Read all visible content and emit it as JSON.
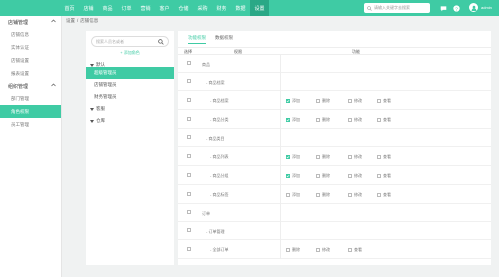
{
  "colors": {
    "accent": "#3fcba4",
    "accent_dark": "#2aa886"
  },
  "topnav": {
    "items": [
      "首页",
      "店铺",
      "商品",
      "订单",
      "营销",
      "客户",
      "仓储",
      "采购",
      "财务",
      "数据",
      "设置"
    ],
    "active": 10,
    "search_placeholder": "请输入关键字去搜索",
    "user": "admin",
    "icons": [
      "search-icon",
      "message-icon",
      "help-icon",
      "bell-icon",
      "avatar-icon"
    ]
  },
  "sidebar": {
    "groups": [
      {
        "title": "店铺管理",
        "expanded": true,
        "items": [
          "店铺信息",
          "实体认证",
          "店铺设置",
          "报表设置"
        ]
      },
      {
        "title": "组织管理",
        "expanded": true,
        "items": [
          "部门管理",
          "角色权限",
          "员工管理"
        ]
      }
    ],
    "active_item": "角色权限"
  },
  "breadcrumb": [
    "设置",
    "/",
    "店铺信息"
  ],
  "role_tree": {
    "search_placeholder": "搜索人员名或者",
    "add_label": "+ 添加角色",
    "nodes": [
      {
        "label": "默认",
        "level": 0,
        "expanded": true
      },
      {
        "label": "超级管理员",
        "level": 1,
        "active": true
      },
      {
        "label": "店铺管理员",
        "level": 1
      },
      {
        "label": "财务管理员",
        "level": 1
      },
      {
        "label": "客服",
        "level": 0,
        "expanded": true
      },
      {
        "label": "仓库",
        "level": 0,
        "expanded": true
      }
    ]
  },
  "permissions": {
    "tabs": [
      "功能权限",
      "数据权限"
    ],
    "active_tab": 0,
    "columns": [
      "选择",
      "权限",
      "功能"
    ],
    "rows": [
      {
        "name": "商品",
        "indent": 0,
        "options": []
      },
      {
        "name": "商品档案",
        "indent": 1,
        "options": []
      },
      {
        "name": "商品档案",
        "indent": 2,
        "options": [
          {
            "label": "添加",
            "on": true
          },
          {
            "label": "删除",
            "on": false
          },
          {
            "label": "修改",
            "on": false
          },
          {
            "label": "查看",
            "on": false
          }
        ]
      },
      {
        "name": "商品分类",
        "indent": 2,
        "options": [
          {
            "label": "添加",
            "on": true
          },
          {
            "label": "删除",
            "on": false
          },
          {
            "label": "修改",
            "on": false
          },
          {
            "label": "查看",
            "on": false
          }
        ]
      },
      {
        "name": "商品类目",
        "indent": 1,
        "options": []
      },
      {
        "name": "商品列表",
        "indent": 2,
        "options": [
          {
            "label": "添加",
            "on": true
          },
          {
            "label": "删除",
            "on": false
          },
          {
            "label": "修改",
            "on": false
          },
          {
            "label": "查看",
            "on": false
          }
        ]
      },
      {
        "name": "商品分组",
        "indent": 2,
        "options": [
          {
            "label": "添加",
            "on": true
          },
          {
            "label": "删除",
            "on": false
          },
          {
            "label": "修改",
            "on": false
          },
          {
            "label": "查看",
            "on": false
          }
        ]
      },
      {
        "name": "商品标签",
        "indent": 2,
        "options": [
          {
            "label": "添加",
            "on": false
          },
          {
            "label": "删除",
            "on": false
          },
          {
            "label": "修改",
            "on": false
          },
          {
            "label": "查看",
            "on": false
          }
        ]
      },
      {
        "name": "订单",
        "indent": 0,
        "options": []
      },
      {
        "name": "订单管理",
        "indent": 1,
        "options": []
      },
      {
        "name": "全部订单",
        "indent": 2,
        "options": [
          {
            "label": "删除",
            "on": false
          },
          {
            "label": "修改",
            "on": false
          },
          {
            "label": "查看",
            "on": false
          }
        ]
      }
    ]
  }
}
